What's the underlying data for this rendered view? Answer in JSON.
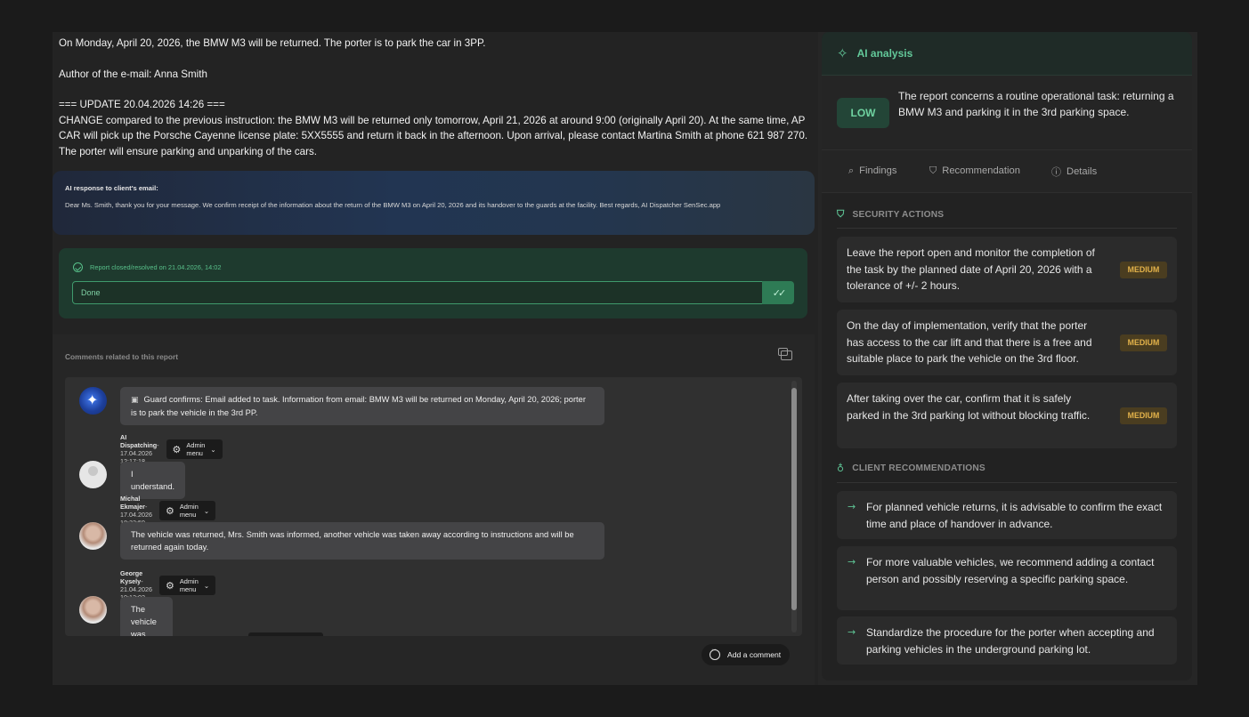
{
  "email": {
    "line1": "On Monday, April 20, 2026, the BMW M3 will be returned. The porter is to park the car in 3PP.",
    "author": "Author of the e-mail: Anna Smith",
    "update_header": "=== UPDATE 20.04.2026 14:26 ===",
    "update_body": "CHANGE compared to the previous instruction: the BMW M3 will be returned only tomorrow, April 21, 2026 at around 9:00 (originally April 20). At the same time, AP CAR will pick up the Porsche Cayenne license plate: 5XX5555 and return it back in the afternoon. Upon arrival, please contact Martina Smith at phone 621 987 270. The porter will ensure parking and unparking of the cars."
  },
  "ai_response": {
    "title": "AI response to client's email:",
    "body": "Dear Ms. Smith, thank you for your message. We confirm receipt of the information about the return of the BMW M3 on April 20, 2026 and its handover to the guards at the facility. Best regards, AI Dispatcher SenSec.app"
  },
  "resolution": {
    "status": "Report closed/resolved on 21.04.2026, 14:02",
    "value": "Done",
    "button_icon": "double-check-icon"
  },
  "comments": {
    "title": "Comments related to this report",
    "admin_menu_label": "Admin menu",
    "items": [
      {
        "text": "Guard confirms: Email added to task. Information from email: BMW M3 will be returned on Monday, April 20, 2026; porter is to park the vehicle in the 3rd PP.",
        "author": "AI Dispatching",
        "time": "- 17.04.2026 12:17:18"
      },
      {
        "text": "I understand.",
        "author": "Michal Ekmajer",
        "time": "- 17.04.2026 18:33:59"
      },
      {
        "text": "The vehicle was returned, Mrs. Smith was informed, another vehicle was taken away according to instructions and will be returned again today.",
        "author": "George Kysely",
        "time": "- 21.04.2026 10:12:02"
      },
      {
        "text": "The vehicle was returned and parked."
      }
    ],
    "add_label": "Add a comment"
  },
  "analysis": {
    "title": "AI analysis",
    "severity": "LOW",
    "summary": "The report concerns a routine operational task: returning a BMW M3 and parking it in the 3rd parking space.",
    "tabs": [
      "Findings",
      "Recommendation",
      "Details"
    ],
    "security_title": "SECURITY ACTIONS",
    "security_actions": [
      {
        "text": "Leave the report open and monitor the completion of the task by the planned date of April 20, 2026 with a tolerance of +/- 2 hours.",
        "priority": "MEDIUM"
      },
      {
        "text": "On the day of implementation, verify that the porter has access to the car lift and that there is a free and suitable place to park the vehicle on the 3rd floor.",
        "priority": "MEDIUM"
      },
      {
        "text": "After taking over the car, confirm that it is safely parked in the 3rd parking lot without blocking traffic.",
        "priority": "MEDIUM"
      }
    ],
    "client_title": "CLIENT RECOMMENDATIONS",
    "client_recommendations": [
      "For planned vehicle returns, it is advisable to confirm the exact time and place of handover in advance.",
      "For more valuable vehicles, we recommend adding a contact person and possibly reserving a specific parking space.",
      "Standardize the procedure for the porter when accepting and parking vehicles in the underground parking lot."
    ]
  },
  "colors": {
    "accent_green": "#63c99a",
    "medium_badge": "#e3b24a",
    "page_bg": "#1b1b1b"
  }
}
